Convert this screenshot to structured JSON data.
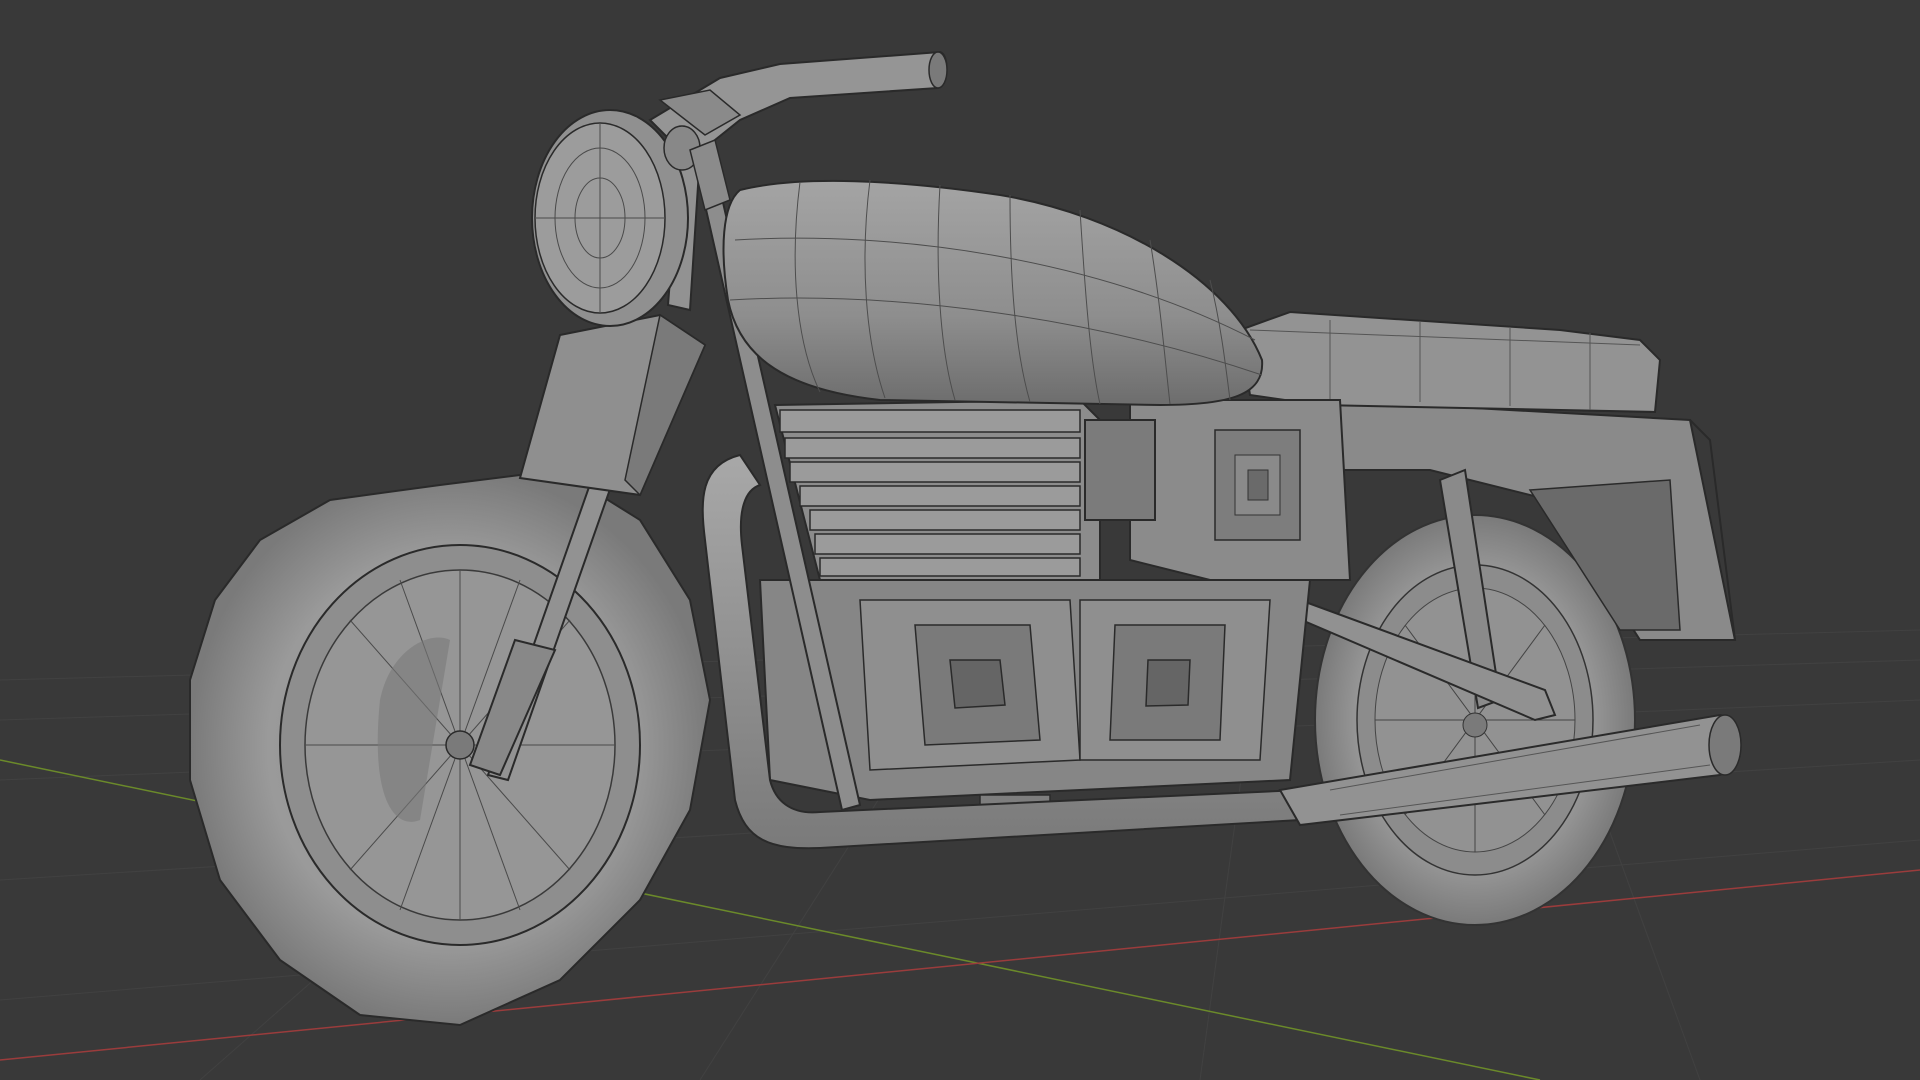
{
  "viewport": {
    "view": "3D Viewport",
    "shading": "solid-wireframe",
    "background_color": "#393939",
    "grid_color": "#454545",
    "axis_x_color": "#9b3c3c",
    "axis_y_color": "#6b8a2a",
    "mesh_base_color": "#8f8f8f",
    "mesh_light_color": "#a3a3a3",
    "mesh_dark_color": "#5e5e5e",
    "wire_color": "#2a2a2a"
  },
  "scene": {
    "object": "motorcycle",
    "parts": [
      "front-wheel",
      "rear-wheel",
      "headlight",
      "handlebar",
      "fuel-tank",
      "seat",
      "engine-block",
      "exhaust-pipe",
      "front-fork",
      "frame",
      "rear-fender",
      "number-plate"
    ]
  }
}
